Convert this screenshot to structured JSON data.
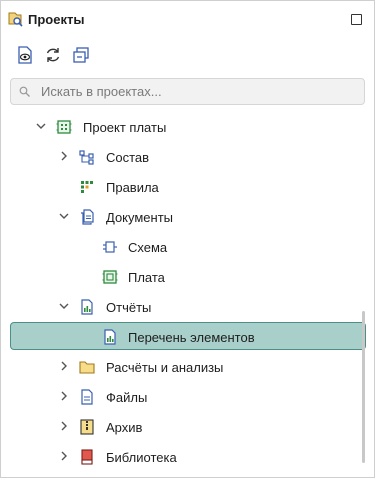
{
  "panel": {
    "title": "Проекты",
    "title_icon": "projects-search-icon",
    "maximize_icon": "maximize-icon"
  },
  "toolbar": {
    "buttons": [
      {
        "icon": "show-document-icon"
      },
      {
        "icon": "refresh-icon"
      },
      {
        "icon": "collapse-all-icon"
      }
    ]
  },
  "search": {
    "placeholder": "Искать в проектах...",
    "value": ""
  },
  "tree": [
    {
      "label": "Проект платы",
      "icon": "board-project-icon",
      "chevron": "down"
    },
    {
      "label": "Состав",
      "icon": "structure-icon",
      "chevron": "right"
    },
    {
      "label": "Правила",
      "icon": "rules-icon",
      "chevron": "none"
    },
    {
      "label": "Документы",
      "icon": "documents-icon",
      "chevron": "down"
    },
    {
      "label": "Схема",
      "icon": "schematic-icon",
      "chevron": "none"
    },
    {
      "label": "Плата",
      "icon": "pcb-icon",
      "chevron": "none"
    },
    {
      "label": "Отчёты",
      "icon": "reports-icon",
      "chevron": "down"
    },
    {
      "label": "Перечень элементов",
      "icon": "report-file-icon",
      "chevron": "none",
      "selected": true
    },
    {
      "label": "Расчёты и анализы",
      "icon": "folder-icon",
      "chevron": "right"
    },
    {
      "label": "Файлы",
      "icon": "file-icon",
      "chevron": "right"
    },
    {
      "label": "Архив",
      "icon": "archive-icon",
      "chevron": "right"
    },
    {
      "label": "Библиотека",
      "icon": "library-icon",
      "chevron": "right"
    }
  ],
  "colors": {
    "selection_bg": "#a9cfcb",
    "selection_border": "#4b8f87",
    "icon_blue": "#3a5fb0",
    "icon_green": "#2e8b3e"
  }
}
